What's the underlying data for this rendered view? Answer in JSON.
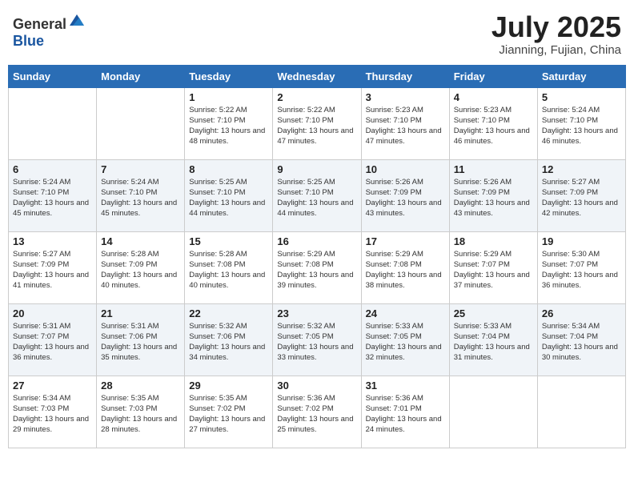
{
  "header": {
    "logo_general": "General",
    "logo_blue": "Blue",
    "month_year": "July 2025",
    "location": "Jianning, Fujian, China"
  },
  "weekdays": [
    "Sunday",
    "Monday",
    "Tuesday",
    "Wednesday",
    "Thursday",
    "Friday",
    "Saturday"
  ],
  "weeks": [
    [
      {
        "day": "",
        "sunrise": "",
        "sunset": "",
        "daylight": ""
      },
      {
        "day": "",
        "sunrise": "",
        "sunset": "",
        "daylight": ""
      },
      {
        "day": "1",
        "sunrise": "Sunrise: 5:22 AM",
        "sunset": "Sunset: 7:10 PM",
        "daylight": "Daylight: 13 hours and 48 minutes."
      },
      {
        "day": "2",
        "sunrise": "Sunrise: 5:22 AM",
        "sunset": "Sunset: 7:10 PM",
        "daylight": "Daylight: 13 hours and 47 minutes."
      },
      {
        "day": "3",
        "sunrise": "Sunrise: 5:23 AM",
        "sunset": "Sunset: 7:10 PM",
        "daylight": "Daylight: 13 hours and 47 minutes."
      },
      {
        "day": "4",
        "sunrise": "Sunrise: 5:23 AM",
        "sunset": "Sunset: 7:10 PM",
        "daylight": "Daylight: 13 hours and 46 minutes."
      },
      {
        "day": "5",
        "sunrise": "Sunrise: 5:24 AM",
        "sunset": "Sunset: 7:10 PM",
        "daylight": "Daylight: 13 hours and 46 minutes."
      }
    ],
    [
      {
        "day": "6",
        "sunrise": "Sunrise: 5:24 AM",
        "sunset": "Sunset: 7:10 PM",
        "daylight": "Daylight: 13 hours and 45 minutes."
      },
      {
        "day": "7",
        "sunrise": "Sunrise: 5:24 AM",
        "sunset": "Sunset: 7:10 PM",
        "daylight": "Daylight: 13 hours and 45 minutes."
      },
      {
        "day": "8",
        "sunrise": "Sunrise: 5:25 AM",
        "sunset": "Sunset: 7:10 PM",
        "daylight": "Daylight: 13 hours and 44 minutes."
      },
      {
        "day": "9",
        "sunrise": "Sunrise: 5:25 AM",
        "sunset": "Sunset: 7:10 PM",
        "daylight": "Daylight: 13 hours and 44 minutes."
      },
      {
        "day": "10",
        "sunrise": "Sunrise: 5:26 AM",
        "sunset": "Sunset: 7:09 PM",
        "daylight": "Daylight: 13 hours and 43 minutes."
      },
      {
        "day": "11",
        "sunrise": "Sunrise: 5:26 AM",
        "sunset": "Sunset: 7:09 PM",
        "daylight": "Daylight: 13 hours and 43 minutes."
      },
      {
        "day": "12",
        "sunrise": "Sunrise: 5:27 AM",
        "sunset": "Sunset: 7:09 PM",
        "daylight": "Daylight: 13 hours and 42 minutes."
      }
    ],
    [
      {
        "day": "13",
        "sunrise": "Sunrise: 5:27 AM",
        "sunset": "Sunset: 7:09 PM",
        "daylight": "Daylight: 13 hours and 41 minutes."
      },
      {
        "day": "14",
        "sunrise": "Sunrise: 5:28 AM",
        "sunset": "Sunset: 7:09 PM",
        "daylight": "Daylight: 13 hours and 40 minutes."
      },
      {
        "day": "15",
        "sunrise": "Sunrise: 5:28 AM",
        "sunset": "Sunset: 7:08 PM",
        "daylight": "Daylight: 13 hours and 40 minutes."
      },
      {
        "day": "16",
        "sunrise": "Sunrise: 5:29 AM",
        "sunset": "Sunset: 7:08 PM",
        "daylight": "Daylight: 13 hours and 39 minutes."
      },
      {
        "day": "17",
        "sunrise": "Sunrise: 5:29 AM",
        "sunset": "Sunset: 7:08 PM",
        "daylight": "Daylight: 13 hours and 38 minutes."
      },
      {
        "day": "18",
        "sunrise": "Sunrise: 5:29 AM",
        "sunset": "Sunset: 7:07 PM",
        "daylight": "Daylight: 13 hours and 37 minutes."
      },
      {
        "day": "19",
        "sunrise": "Sunrise: 5:30 AM",
        "sunset": "Sunset: 7:07 PM",
        "daylight": "Daylight: 13 hours and 36 minutes."
      }
    ],
    [
      {
        "day": "20",
        "sunrise": "Sunrise: 5:31 AM",
        "sunset": "Sunset: 7:07 PM",
        "daylight": "Daylight: 13 hours and 36 minutes."
      },
      {
        "day": "21",
        "sunrise": "Sunrise: 5:31 AM",
        "sunset": "Sunset: 7:06 PM",
        "daylight": "Daylight: 13 hours and 35 minutes."
      },
      {
        "day": "22",
        "sunrise": "Sunrise: 5:32 AM",
        "sunset": "Sunset: 7:06 PM",
        "daylight": "Daylight: 13 hours and 34 minutes."
      },
      {
        "day": "23",
        "sunrise": "Sunrise: 5:32 AM",
        "sunset": "Sunset: 7:05 PM",
        "daylight": "Daylight: 13 hours and 33 minutes."
      },
      {
        "day": "24",
        "sunrise": "Sunrise: 5:33 AM",
        "sunset": "Sunset: 7:05 PM",
        "daylight": "Daylight: 13 hours and 32 minutes."
      },
      {
        "day": "25",
        "sunrise": "Sunrise: 5:33 AM",
        "sunset": "Sunset: 7:04 PM",
        "daylight": "Daylight: 13 hours and 31 minutes."
      },
      {
        "day": "26",
        "sunrise": "Sunrise: 5:34 AM",
        "sunset": "Sunset: 7:04 PM",
        "daylight": "Daylight: 13 hours and 30 minutes."
      }
    ],
    [
      {
        "day": "27",
        "sunrise": "Sunrise: 5:34 AM",
        "sunset": "Sunset: 7:03 PM",
        "daylight": "Daylight: 13 hours and 29 minutes."
      },
      {
        "day": "28",
        "sunrise": "Sunrise: 5:35 AM",
        "sunset": "Sunset: 7:03 PM",
        "daylight": "Daylight: 13 hours and 28 minutes."
      },
      {
        "day": "29",
        "sunrise": "Sunrise: 5:35 AM",
        "sunset": "Sunset: 7:02 PM",
        "daylight": "Daylight: 13 hours and 27 minutes."
      },
      {
        "day": "30",
        "sunrise": "Sunrise: 5:36 AM",
        "sunset": "Sunset: 7:02 PM",
        "daylight": "Daylight: 13 hours and 25 minutes."
      },
      {
        "day": "31",
        "sunrise": "Sunrise: 5:36 AM",
        "sunset": "Sunset: 7:01 PM",
        "daylight": "Daylight: 13 hours and 24 minutes."
      },
      {
        "day": "",
        "sunrise": "",
        "sunset": "",
        "daylight": ""
      },
      {
        "day": "",
        "sunrise": "",
        "sunset": "",
        "daylight": ""
      }
    ]
  ]
}
